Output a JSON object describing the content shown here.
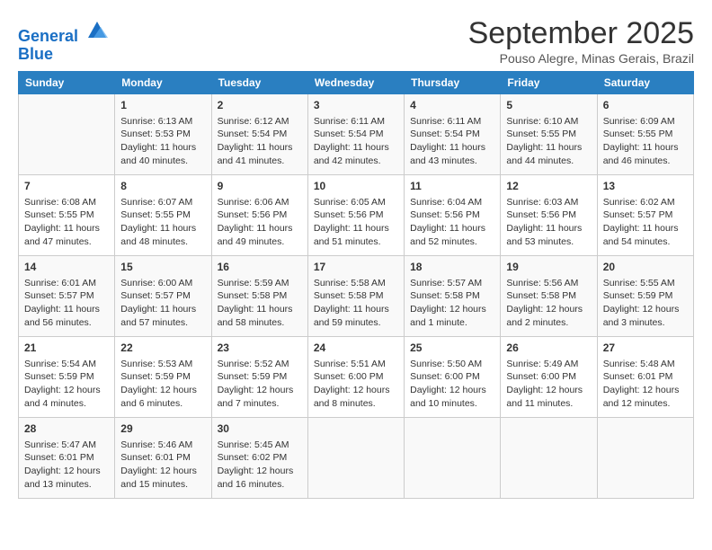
{
  "header": {
    "logo_line1": "General",
    "logo_line2": "Blue",
    "month": "September 2025",
    "location": "Pouso Alegre, Minas Gerais, Brazil"
  },
  "weekdays": [
    "Sunday",
    "Monday",
    "Tuesday",
    "Wednesday",
    "Thursday",
    "Friday",
    "Saturday"
  ],
  "weeks": [
    [
      {
        "day": "",
        "info": ""
      },
      {
        "day": "1",
        "info": "Sunrise: 6:13 AM\nSunset: 5:53 PM\nDaylight: 11 hours\nand 40 minutes."
      },
      {
        "day": "2",
        "info": "Sunrise: 6:12 AM\nSunset: 5:54 PM\nDaylight: 11 hours\nand 41 minutes."
      },
      {
        "day": "3",
        "info": "Sunrise: 6:11 AM\nSunset: 5:54 PM\nDaylight: 11 hours\nand 42 minutes."
      },
      {
        "day": "4",
        "info": "Sunrise: 6:11 AM\nSunset: 5:54 PM\nDaylight: 11 hours\nand 43 minutes."
      },
      {
        "day": "5",
        "info": "Sunrise: 6:10 AM\nSunset: 5:55 PM\nDaylight: 11 hours\nand 44 minutes."
      },
      {
        "day": "6",
        "info": "Sunrise: 6:09 AM\nSunset: 5:55 PM\nDaylight: 11 hours\nand 46 minutes."
      }
    ],
    [
      {
        "day": "7",
        "info": "Sunrise: 6:08 AM\nSunset: 5:55 PM\nDaylight: 11 hours\nand 47 minutes."
      },
      {
        "day": "8",
        "info": "Sunrise: 6:07 AM\nSunset: 5:55 PM\nDaylight: 11 hours\nand 48 minutes."
      },
      {
        "day": "9",
        "info": "Sunrise: 6:06 AM\nSunset: 5:56 PM\nDaylight: 11 hours\nand 49 minutes."
      },
      {
        "day": "10",
        "info": "Sunrise: 6:05 AM\nSunset: 5:56 PM\nDaylight: 11 hours\nand 51 minutes."
      },
      {
        "day": "11",
        "info": "Sunrise: 6:04 AM\nSunset: 5:56 PM\nDaylight: 11 hours\nand 52 minutes."
      },
      {
        "day": "12",
        "info": "Sunrise: 6:03 AM\nSunset: 5:56 PM\nDaylight: 11 hours\nand 53 minutes."
      },
      {
        "day": "13",
        "info": "Sunrise: 6:02 AM\nSunset: 5:57 PM\nDaylight: 11 hours\nand 54 minutes."
      }
    ],
    [
      {
        "day": "14",
        "info": "Sunrise: 6:01 AM\nSunset: 5:57 PM\nDaylight: 11 hours\nand 56 minutes."
      },
      {
        "day": "15",
        "info": "Sunrise: 6:00 AM\nSunset: 5:57 PM\nDaylight: 11 hours\nand 57 minutes."
      },
      {
        "day": "16",
        "info": "Sunrise: 5:59 AM\nSunset: 5:58 PM\nDaylight: 11 hours\nand 58 minutes."
      },
      {
        "day": "17",
        "info": "Sunrise: 5:58 AM\nSunset: 5:58 PM\nDaylight: 11 hours\nand 59 minutes."
      },
      {
        "day": "18",
        "info": "Sunrise: 5:57 AM\nSunset: 5:58 PM\nDaylight: 12 hours\nand 1 minute."
      },
      {
        "day": "19",
        "info": "Sunrise: 5:56 AM\nSunset: 5:58 PM\nDaylight: 12 hours\nand 2 minutes."
      },
      {
        "day": "20",
        "info": "Sunrise: 5:55 AM\nSunset: 5:59 PM\nDaylight: 12 hours\nand 3 minutes."
      }
    ],
    [
      {
        "day": "21",
        "info": "Sunrise: 5:54 AM\nSunset: 5:59 PM\nDaylight: 12 hours\nand 4 minutes."
      },
      {
        "day": "22",
        "info": "Sunrise: 5:53 AM\nSunset: 5:59 PM\nDaylight: 12 hours\nand 6 minutes."
      },
      {
        "day": "23",
        "info": "Sunrise: 5:52 AM\nSunset: 5:59 PM\nDaylight: 12 hours\nand 7 minutes."
      },
      {
        "day": "24",
        "info": "Sunrise: 5:51 AM\nSunset: 6:00 PM\nDaylight: 12 hours\nand 8 minutes."
      },
      {
        "day": "25",
        "info": "Sunrise: 5:50 AM\nSunset: 6:00 PM\nDaylight: 12 hours\nand 10 minutes."
      },
      {
        "day": "26",
        "info": "Sunrise: 5:49 AM\nSunset: 6:00 PM\nDaylight: 12 hours\nand 11 minutes."
      },
      {
        "day": "27",
        "info": "Sunrise: 5:48 AM\nSunset: 6:01 PM\nDaylight: 12 hours\nand 12 minutes."
      }
    ],
    [
      {
        "day": "28",
        "info": "Sunrise: 5:47 AM\nSunset: 6:01 PM\nDaylight: 12 hours\nand 13 minutes."
      },
      {
        "day": "29",
        "info": "Sunrise: 5:46 AM\nSunset: 6:01 PM\nDaylight: 12 hours\nand 15 minutes."
      },
      {
        "day": "30",
        "info": "Sunrise: 5:45 AM\nSunset: 6:02 PM\nDaylight: 12 hours\nand 16 minutes."
      },
      {
        "day": "",
        "info": ""
      },
      {
        "day": "",
        "info": ""
      },
      {
        "day": "",
        "info": ""
      },
      {
        "day": "",
        "info": ""
      }
    ]
  ]
}
